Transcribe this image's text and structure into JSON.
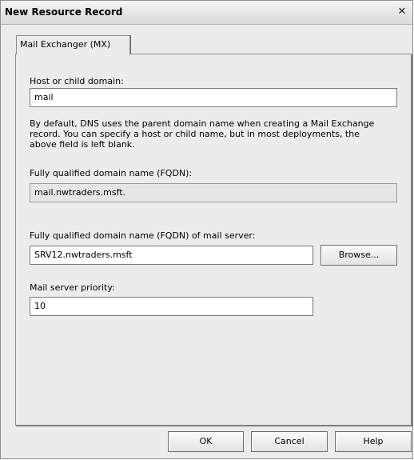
{
  "window": {
    "title": "New Resource Record"
  },
  "tabs": [
    {
      "label": "Mail Exchanger (MX)"
    }
  ],
  "form": {
    "host_label": "Host or child domain:",
    "host_value": "mail",
    "description": "By default, DNS uses the parent domain name when creating a Mail Exchange record. You can specify a host or child name, but in most deployments, the above field is left blank.",
    "fqdn_label": "Fully qualified domain name (FQDN):",
    "fqdn_value": "mail.nwtraders.msft.",
    "mailserver_label": "Fully qualified domain name (FQDN) of mail server:",
    "mailserver_value": "SRV12.nwtraders.msft",
    "browse_label": "Browse...",
    "priority_label": "Mail server priority:",
    "priority_value": "10"
  },
  "buttons": {
    "ok": "OK",
    "cancel": "Cancel",
    "help": "Help"
  },
  "icons": {
    "close": "close-icon"
  }
}
